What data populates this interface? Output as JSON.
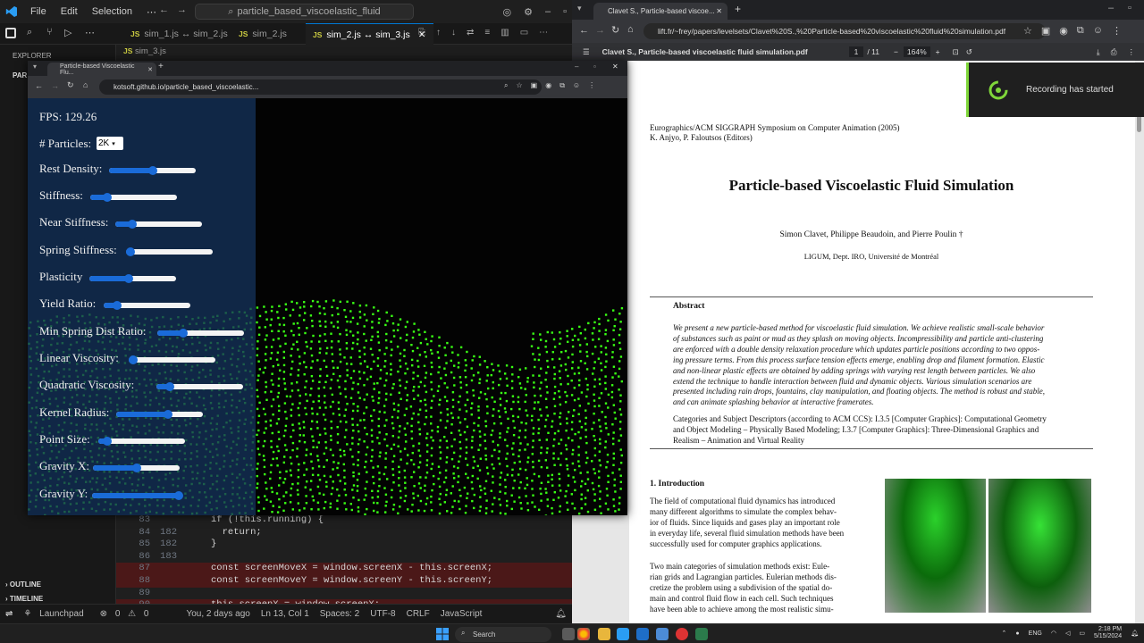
{
  "vscode": {
    "menu": [
      "File",
      "Edit",
      "Selection"
    ],
    "search_text": "particle_based_viscoelastic_fluid",
    "tabs": [
      {
        "label": "sim_1.js ↔ sim_2.js",
        "active": false
      },
      {
        "label": "sim_2.js",
        "active": false
      },
      {
        "label": "sim_2.js ↔ sim_3.js",
        "active": true
      }
    ],
    "subtab": "sim_3.js",
    "explorer_label": "EXPLORER",
    "tree_root": "PAR",
    "outline_label": "OUTLINE",
    "timeline_label": "TIMELINE",
    "code_lines": [
      {
        "ln": "83",
        "ln2": "",
        "code": "if (!this.running) {",
        "del": false
      },
      {
        "ln": "84",
        "ln2": "182",
        "code": "  return;",
        "del": false
      },
      {
        "ln": "85",
        "ln2": "182",
        "code": "}",
        "del": false
      },
      {
        "ln": "86",
        "ln2": "183",
        "code": "",
        "del": false
      },
      {
        "ln": "87",
        "ln2": "",
        "code": "const screenMoveX = window.screenX - this.screenX;",
        "del": true
      },
      {
        "ln": "88",
        "ln2": "",
        "code": "const screenMoveY = window.screenY - this.screenY;",
        "del": true
      },
      {
        "ln": "89",
        "ln2": "",
        "code": "",
        "del": false
      },
      {
        "ln": "90",
        "ln2": "",
        "code": "this.screenX = window.screenX;",
        "del": true
      }
    ],
    "status": {
      "launchpad": "Launchpad",
      "problems": "0",
      "warnings": "0",
      "blame": "You, 2 days ago",
      "position": "Ln 13, Col 1",
      "spaces": "Spaces: 2",
      "encoding": "UTF-8",
      "eol": "CRLF",
      "language": "JavaScript"
    }
  },
  "sim_browser": {
    "tab_title": "Particle-based Viscoelastic Flu...",
    "url": "kotsoft.github.io/particle_based_viscoelastic...",
    "fps_label": "FPS: 129.26",
    "particles_label": "# Particles:",
    "particles_value": "2K",
    "sliders": [
      {
        "label": "Rest Density:",
        "value": 0.5
      },
      {
        "label": "Stiffness:",
        "value": 0.2
      },
      {
        "label": "Near Stiffness:",
        "value": 0.2
      },
      {
        "label": "Spring Stiffness:",
        "value": 0.05
      },
      {
        "label": "Plasticity",
        "value": 0.45
      },
      {
        "label": "Yield Ratio:",
        "value": 0.15
      },
      {
        "label": "Min Spring Dist Ratio:",
        "value": 0.3
      },
      {
        "label": "Linear Viscosity:",
        "value": 0.05
      },
      {
        "label": "Quadratic Viscosity:",
        "value": 0.15
      },
      {
        "label": "Kernel Radius:",
        "value": 0.6
      },
      {
        "label": "Point Size:",
        "value": 0.1
      },
      {
        "label": "Gravity X:",
        "value": 0.5
      },
      {
        "label": "Gravity Y:",
        "value": 1.0
      }
    ]
  },
  "pdf_browser": {
    "tab_title": "Clavet S., Particle-based viscoe...",
    "url": "lift.fr/~frey/papers/levelsets/Clavet%20S.,%20Particle-based%20viscoelastic%20fluid%20simulation.pdf",
    "doc_title": "Clavet S., Particle-based viscoelastic fluid simulation.pdf",
    "page_current": "1",
    "page_total": "/ 11",
    "zoom": "164%",
    "toast": "Recording has started"
  },
  "paper": {
    "venue": "Eurographics/ACM SIGGRAPH Symposium on Computer Animation (2005)",
    "editors": "K. Anjyo, P. Faloutsos (Editors)",
    "title": "Particle-based Viscoelastic Fluid Simulation",
    "authors": "Simon Clavet, Philippe Beaudoin, and Pierre Poulin †",
    "affiliation": "LIGUM, Dept. IRO, Université de Montréal",
    "abstract_heading": "Abstract",
    "abstract_lines": [
      "We present a new particle-based method for viscoelastic fluid simulation. We achieve realistic small-scale behavior",
      "of substances such as paint or mud as they splash on moving objects. Incompressibility and particle anti-clustering",
      "are enforced with a double density relaxation procedure which updates particle positions according to two oppos-",
      "ing pressure terms. From this process surface tension effects emerge, enabling drop and filament formation. Elastic",
      "and non-linear plastic effects are obtained by adding springs with varying rest length between particles. We also",
      "extend the technique to handle interaction between fluid and dynamic objects. Various simulation scenarios are",
      "presented including rain drops, fountains, clay manipulation, and floating objects. The method is robust and stable,",
      "and can animate splashing behavior at interactive framerates."
    ],
    "categories_lines": [
      "Categories and Subject Descriptors (according to ACM CCS):  I.3.5 [Computer Graphics]: Computational Geometry",
      "and Object Modeling – Physically Based Modeling; I.3.7 [Computer Graphics]: Three-Dimensional Graphics and",
      "Realism – Animation and Virtual Reality"
    ],
    "section_heading": "1.  Introduction",
    "intro_lines": [
      "The field of computational fluid dynamics has introduced",
      "many different algorithms to simulate the complex behav-",
      "ior of fluids. Since liquids and gases play an important role",
      "in everyday life, several fluid simulation methods have been",
      "successfully used for computer graphics applications.",
      "",
      "    Two main categories of simulation methods exist: Eule-",
      "rian grids and Lagrangian particles. Eulerian methods dis-",
      "cretize the problem using a subdivision of the spatial do-",
      "main and control fluid flow in each cell. Such techniques",
      "have been able to achieve among the most realistic simu-"
    ]
  },
  "taskbar": {
    "search": "Search",
    "lang": "ENG",
    "time": "2:18 PM",
    "date": "5/15/2024"
  },
  "colors": {
    "vscode_bg": "#1e1e1e",
    "accent": "#0078d4",
    "particle": "#39ff14",
    "slider_fill": "#1a6bd8",
    "toast_accent": "#7fd63a"
  }
}
